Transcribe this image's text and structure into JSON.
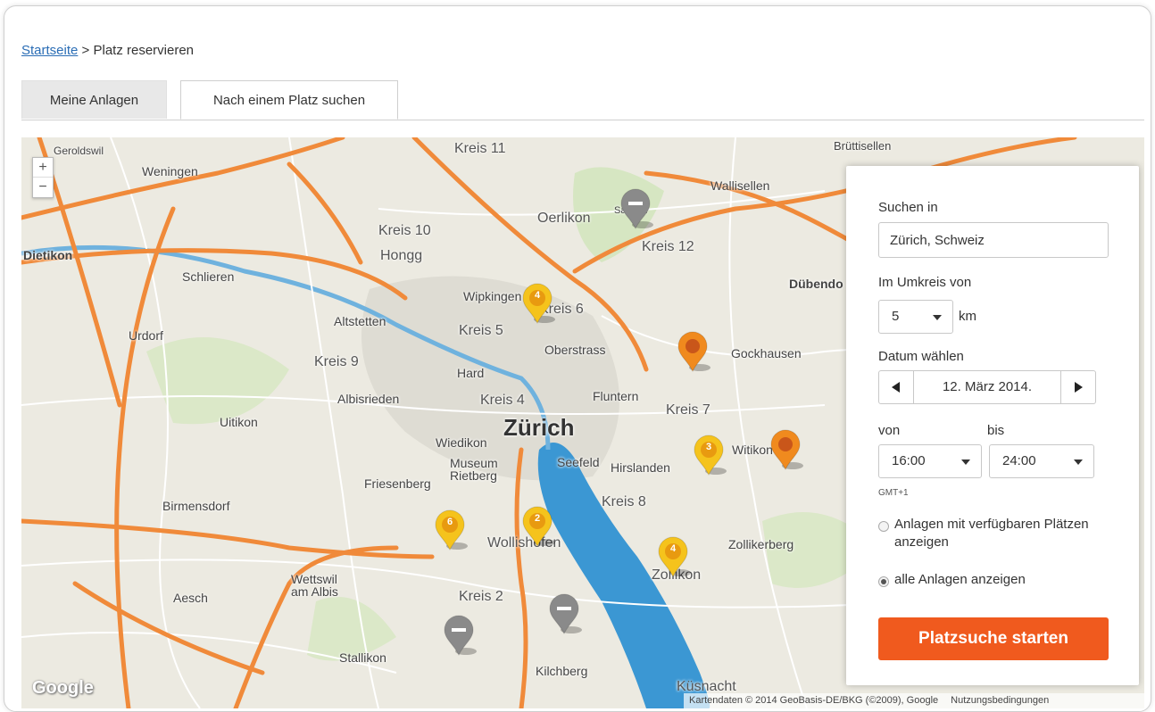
{
  "breadcrumb": {
    "home": "Startseite",
    "separator": " > ",
    "current": "Platz reservieren"
  },
  "tabs": [
    {
      "label": "Meine Anlagen"
    },
    {
      "label": "Nach einem Platz suchen"
    }
  ],
  "map": {
    "zoom_in": "+",
    "zoom_out": "−",
    "labels": {
      "zuerich": "Zürich",
      "kreis11": "Kreis 11",
      "kreis10": "Kreis 10",
      "kreis12": "Kreis 12",
      "kreis6": "Kreis 6",
      "kreis5": "Kreis 5",
      "kreis9": "Kreis 9",
      "kreis4": "Kreis 4",
      "kreis7": "Kreis 7",
      "kreis8": "Kreis 8",
      "kreis2": "Kreis 2",
      "oerlikon": "Oerlikon",
      "wallisellen": "Wallisellen",
      "duebendorf": "Dübendo",
      "hongg": "Hongg",
      "wipkingen": "Wipkingen",
      "altstetten": "Altstetten",
      "oberstrass": "Oberstrass",
      "fluntern": "Fluntern",
      "hirslanden": "Hirslanden",
      "seefeld": "Seefeld",
      "wiedikon": "Wiedikon",
      "albisrieden": "Albisrieden",
      "schlieren": "Schlieren",
      "dietikon": "Dietikon",
      "weningen": "Weningen",
      "urdorf": "Urdorf",
      "uitikon": "Uitikon",
      "birmensdorf": "Birmensdorf",
      "friesenberg": "Friesenberg",
      "wollishofen": "Wollishofen",
      "zollikon": "Zollikon",
      "zollikerberg": "Zollikerberg",
      "witikon": "Witikon",
      "gockhausen": "Gockhausen",
      "aesch": "Aesch",
      "wettswil": "Wettswil am Albis",
      "stallikon": "Stallikon",
      "kilchberg": "Kilchberg",
      "kuesnacht": "Küsnacht",
      "saatlen": "Saatlen",
      "hard": "Hard",
      "brettisellen": "Brüttisellen",
      "geroldswil": "Geroldswil",
      "museum": "Museum Rietberg"
    },
    "markers": [
      {
        "kind": "closed",
        "label": ""
      },
      {
        "kind": "count",
        "label": "4"
      },
      {
        "kind": "single",
        "label": ""
      },
      {
        "kind": "count",
        "label": "3"
      },
      {
        "kind": "single",
        "label": ""
      },
      {
        "kind": "count",
        "label": "6"
      },
      {
        "kind": "count",
        "label": "2"
      },
      {
        "kind": "count",
        "label": "4"
      },
      {
        "kind": "closed",
        "label": ""
      },
      {
        "kind": "closed",
        "label": ""
      }
    ],
    "google_logo": "Google",
    "attribution": "Kartendaten © 2014 GeoBasis-DE/BKG (©2009), Google",
    "terms": "Nutzungsbedingungen",
    "colors": {
      "water": "#3b97d3",
      "highway": "#f08a3a",
      "road": "#ffffff",
      "marker_yellow": "#f5c31c",
      "marker_orange": "#f08a1e",
      "marker_grey": "#8a8a8a"
    }
  },
  "search": {
    "search_in_label": "Suchen in",
    "search_in_value": "Zürich, Schweiz",
    "radius_label": "Im Umkreis von",
    "radius_value": "5",
    "radius_unit": "km",
    "date_label": "Datum wählen",
    "date_value": "12. März 2014.",
    "from_label": "von",
    "to_label": "bis",
    "from_value": "16:00",
    "to_value": "24:00",
    "timezone": "GMT+1",
    "option_available": "Anlagen mit verfügbaren Plätzen anzeigen",
    "option_all": "alle Anlagen anzeigen",
    "selected_option": "all",
    "submit_label": "Platzsuche starten",
    "accent_color": "#f05a1e"
  }
}
